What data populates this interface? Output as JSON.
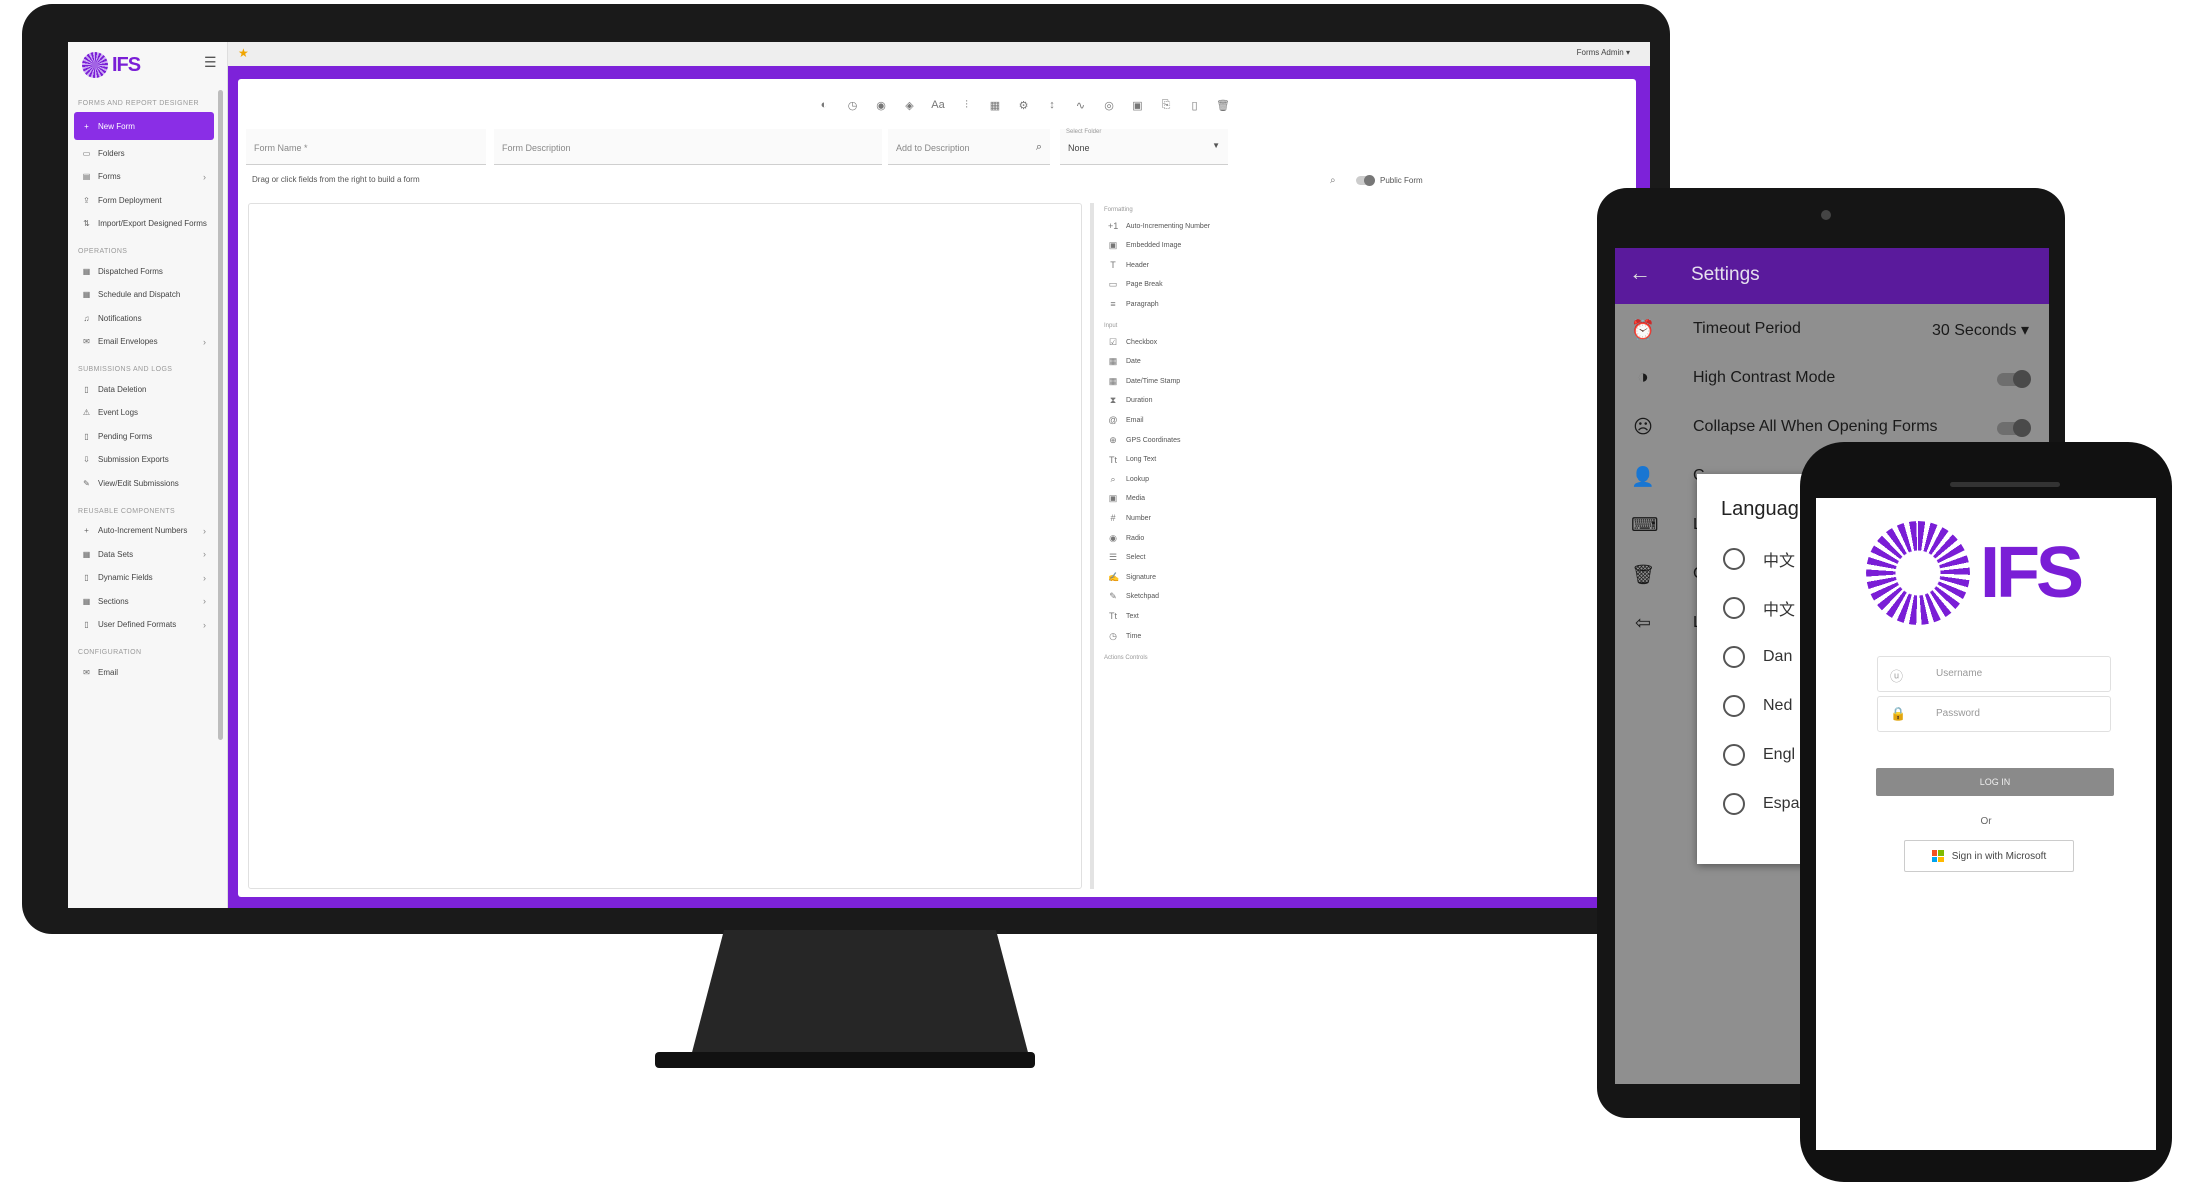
{
  "desktop": {
    "brand": "IFS",
    "topbar": {
      "user": "Forms Admin"
    },
    "sidebar": {
      "sections": [
        {
          "title": "FORMS AND REPORT DESIGNER",
          "items": [
            {
              "label": "New Form",
              "icon": "+",
              "active": true
            },
            {
              "label": "Folders",
              "icon": "▭"
            },
            {
              "label": "Forms",
              "icon": "▤",
              "chevron": true
            },
            {
              "label": "Form Deployment",
              "icon": "⇪"
            },
            {
              "label": "Import/Export Designed Forms",
              "icon": "⇅"
            }
          ]
        },
        {
          "title": "OPERATIONS",
          "items": [
            {
              "label": "Dispatched Forms",
              "icon": "▦"
            },
            {
              "label": "Schedule and Dispatch",
              "icon": "▦"
            },
            {
              "label": "Notifications",
              "icon": "♫"
            },
            {
              "label": "Email Envelopes",
              "icon": "✉",
              "chevron": true
            }
          ]
        },
        {
          "title": "SUBMISSIONS AND LOGS",
          "items": [
            {
              "label": "Data Deletion",
              "icon": "▯"
            },
            {
              "label": "Event Logs",
              "icon": "⚠"
            },
            {
              "label": "Pending Forms",
              "icon": "▯"
            },
            {
              "label": "Submission Exports",
              "icon": "⇩"
            },
            {
              "label": "View/Edit Submissions",
              "icon": "✎"
            }
          ]
        },
        {
          "title": "REUSABLE COMPONENTS",
          "items": [
            {
              "label": "Auto-Increment Numbers",
              "icon": "+",
              "chevron": true
            },
            {
              "label": "Data Sets",
              "icon": "▦",
              "chevron": true
            },
            {
              "label": "Dynamic Fields",
              "icon": "▯",
              "chevron": true
            },
            {
              "label": "Sections",
              "icon": "▦",
              "chevron": true
            },
            {
              "label": "User Defined Formats",
              "icon": "▯",
              "chevron": true
            }
          ]
        },
        {
          "title": "CONFIGURATION",
          "items": [
            {
              "label": "Email",
              "icon": "✉"
            }
          ]
        }
      ]
    },
    "builder": {
      "toolbar_icons": [
        "toggle-icon",
        "clock-icon",
        "pin-icon",
        "layers-icon",
        "text-format-icon",
        "chart-icon",
        "calendar-icon",
        "settings-icon",
        "sort-icon",
        "formula-icon",
        "eye-icon",
        "save-icon",
        "copy-icon",
        "delete-icon",
        "trash-icon"
      ],
      "form_name_placeholder": "Form Name *",
      "form_description_placeholder": "Form Description",
      "add_description_placeholder": "Add to Description",
      "select_folder_label": "Select Folder",
      "select_folder_value": "None",
      "hint": "Drag or click fields from the right to build a form",
      "public_form_label": "Public Form",
      "palette": [
        {
          "group": "Formatting",
          "items": [
            {
              "label": "Auto-Incrementing Number",
              "icon": "+1"
            },
            {
              "label": "Embedded Image",
              "icon": "▣"
            },
            {
              "label": "Header",
              "icon": "T"
            },
            {
              "label": "Page Break",
              "icon": "▭"
            },
            {
              "label": "Paragraph",
              "icon": "≡"
            }
          ]
        },
        {
          "group": "Input",
          "items": [
            {
              "label": "Checkbox",
              "icon": "☑"
            },
            {
              "label": "Date",
              "icon": "▦"
            },
            {
              "label": "Date/Time Stamp",
              "icon": "▦"
            },
            {
              "label": "Duration",
              "icon": "⧗"
            },
            {
              "label": "Email",
              "icon": "@"
            },
            {
              "label": "GPS Coordinates",
              "icon": "⊕"
            },
            {
              "label": "Long Text",
              "icon": "Tt"
            },
            {
              "label": "Lookup",
              "icon": "⌕"
            },
            {
              "label": "Media",
              "icon": "▣"
            },
            {
              "label": "Number",
              "icon": "#"
            },
            {
              "label": "Radio",
              "icon": "◉"
            },
            {
              "label": "Select",
              "icon": "☰"
            },
            {
              "label": "Signature",
              "icon": "✍"
            },
            {
              "label": "Sketchpad",
              "icon": "✎"
            },
            {
              "label": "Text",
              "icon": "Tt"
            },
            {
              "label": "Time",
              "icon": "◷"
            }
          ]
        },
        {
          "group": "Actions Controls",
          "items": []
        }
      ]
    }
  },
  "tablet": {
    "title": "Settings",
    "rows": [
      {
        "icon": "⏰",
        "label": "Timeout Period",
        "value": "30 Seconds ▾"
      },
      {
        "icon": "◑",
        "label": "High Contrast Mode",
        "toggle": true
      },
      {
        "icon": "☹",
        "label": "Collapse All When Opening Forms",
        "toggle": true
      },
      {
        "icon": "👤",
        "label": "C"
      },
      {
        "icon": "⌨",
        "label": "L"
      },
      {
        "icon": "🗑",
        "label": "C"
      },
      {
        "icon": "⇦",
        "label": "L"
      }
    ],
    "language_dialog": {
      "title": "Languag",
      "options": [
        "中文",
        "中文",
        "Dan",
        "Ned",
        "Engl",
        "Espa"
      ]
    }
  },
  "phone": {
    "brand": "IFS",
    "username_placeholder": "Username",
    "password_placeholder": "Password",
    "login_label": "LOG IN",
    "or_label": "Or",
    "microsoft_label": "Sign in with Microsoft",
    "microsoft_colors": [
      "#f25022",
      "#7fba00",
      "#00a4ef",
      "#ffb900"
    ]
  }
}
